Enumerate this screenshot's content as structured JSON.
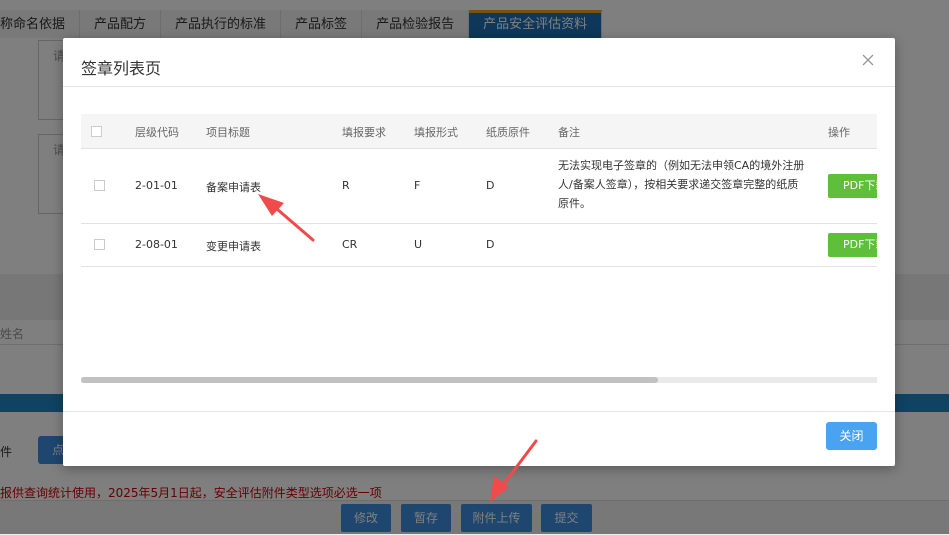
{
  "tabs": [
    {
      "label": "称命名依据",
      "active": false
    },
    {
      "label": "产品配方",
      "active": false
    },
    {
      "label": "产品执行的标准",
      "active": false
    },
    {
      "label": "产品标签",
      "active": false
    },
    {
      "label": "产品检验报告",
      "active": false
    },
    {
      "label": "产品安全评估资料",
      "active": true
    }
  ],
  "background": {
    "textarea_placeholder_1": "请",
    "textarea_placeholder_2": "请",
    "name_field_label": "姓名",
    "attachment_label": "件",
    "click_button_label": "点",
    "notice_text": "报供查询统计使用，2025年5月1日起，安全评估附件类型选项必选一项",
    "buttons": {
      "modify": "修改",
      "save_draft": "暂存",
      "upload_attachment": "附件上传",
      "submit": "提交"
    }
  },
  "modal": {
    "title": "签章列表页",
    "columns": {
      "level_code": "层级代码",
      "item_title": "项目标题",
      "fill_requirement": "填报要求",
      "fill_form": "填报形式",
      "paper_original": "纸质原件",
      "remark": "备注",
      "action": "操作"
    },
    "rows": [
      {
        "level_code": "2-01-01",
        "item_title": "备案申请表",
        "fill_requirement": "R",
        "fill_form": "F",
        "paper_original": "D",
        "remark": "无法实现电子签章的（例如无法申领CA的境外注册人/备案人签章），按相关要求递交签章完整的纸质原件。",
        "action_label": "PDF下载"
      },
      {
        "level_code": "2-08-01",
        "item_title": "变更申请表",
        "fill_requirement": "CR",
        "fill_form": "U",
        "paper_original": "D",
        "remark": "",
        "action_label": "PDF下载"
      }
    ],
    "close_label": "关闭"
  },
  "colors": {
    "active_tab": "#1f6fb2",
    "primary_button": "#3c8dde",
    "pdf_button": "#5fbf3a",
    "close_button": "#4aa3f0",
    "annotation_arrow": "#f04a4a",
    "notice": "#cc0000"
  }
}
